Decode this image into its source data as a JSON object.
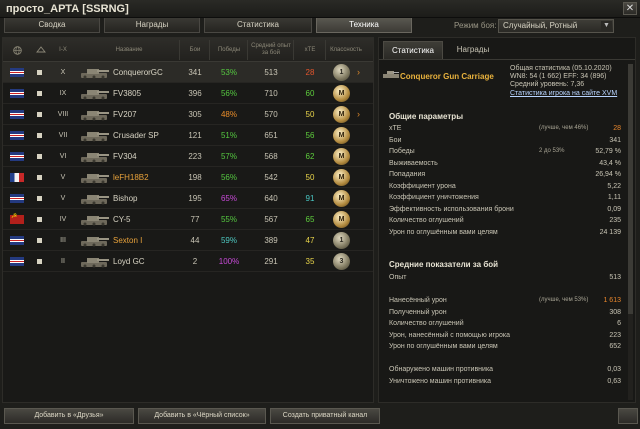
{
  "window": {
    "title": "просто_АРТА [SSRNG]",
    "close_glyph": "✕"
  },
  "tabs": [
    {
      "label": "Сводка"
    },
    {
      "label": "Награды"
    },
    {
      "label": "Статистика"
    },
    {
      "label": "Техника"
    }
  ],
  "battle_mode": {
    "label": "Режим боя:",
    "value": "Случайный, Ротный",
    "arrow": "▼"
  },
  "table": {
    "headers": {
      "name": "Название",
      "battles": "Бои",
      "wins": "Победы",
      "avg_xp": "Средний опыт за бой",
      "xte": "xTE",
      "mastery": "Классность",
      "tier": "I-X"
    },
    "rows": [
      {
        "nation": "uk",
        "tier": "X",
        "name": "ConquerorGC",
        "battles": "341",
        "wins": "53%",
        "wins_color": "green",
        "xp": "513",
        "xte": "28",
        "xte_color": "red",
        "mastery": "1",
        "selected": true,
        "arrow": "›"
      },
      {
        "nation": "uk",
        "tier": "IX",
        "name": "FV3805",
        "battles": "396",
        "wins": "56%",
        "wins_color": "green",
        "xp": "710",
        "xte": "60",
        "xte_color": "green",
        "mastery": "M",
        "selected": false,
        "arrow": ""
      },
      {
        "nation": "uk",
        "tier": "VIII",
        "name": "FV207",
        "battles": "305",
        "wins": "48%",
        "wins_color": "orange",
        "xp": "570",
        "xte": "50",
        "xte_color": "yellow",
        "mastery": "M",
        "selected": false,
        "arrow": "›"
      },
      {
        "nation": "uk",
        "tier": "VII",
        "name": "Crusader SP",
        "battles": "121",
        "wins": "51%",
        "wins_color": "green",
        "xp": "651",
        "xte": "56",
        "xte_color": "green",
        "mastery": "M",
        "selected": false,
        "arrow": ""
      },
      {
        "nation": "uk",
        "tier": "VI",
        "name": "FV304",
        "battles": "223",
        "wins": "57%",
        "wins_color": "green",
        "xp": "568",
        "xte": "62",
        "xte_color": "green",
        "mastery": "M",
        "selected": false,
        "arrow": ""
      },
      {
        "nation": "fr",
        "tier": "V",
        "name": "leFH18B2",
        "battles": "198",
        "wins": "56%",
        "wins_color": "green",
        "xp": "542",
        "xte": "50",
        "xte_color": "yellow",
        "mastery": "M",
        "selected": false,
        "arrow": "",
        "gold": true
      },
      {
        "nation": "uk",
        "tier": "V",
        "name": "Bishop",
        "battles": "195",
        "wins": "65%",
        "wins_color": "purple",
        "xp": "640",
        "xte": "91",
        "xte_color": "cyan",
        "mastery": "M",
        "selected": false,
        "arrow": ""
      },
      {
        "nation": "su",
        "tier": "IV",
        "name": "CY-5",
        "battles": "77",
        "wins": "55%",
        "wins_color": "green",
        "xp": "567",
        "xte": "65",
        "xte_color": "green",
        "mastery": "M",
        "selected": false,
        "arrow": ""
      },
      {
        "nation": "uk",
        "tier": "III",
        "name": "Sexton I",
        "battles": "44",
        "wins": "59%",
        "wins_color": "cyan",
        "xp": "389",
        "xte": "47",
        "xte_color": "yellow",
        "mastery": "1",
        "selected": false,
        "arrow": "",
        "gold": true
      },
      {
        "nation": "uk",
        "tier": "II",
        "name": "Loyd GC",
        "battles": "2",
        "wins": "100%",
        "wins_color": "purple",
        "xp": "291",
        "xte": "35",
        "xte_color": "yellow",
        "mastery": "3",
        "selected": false,
        "arrow": ""
      }
    ]
  },
  "right": {
    "tabs": [
      {
        "label": "Статистика"
      },
      {
        "label": "Награды"
      }
    ],
    "tank_title": "Conqueror Gun Carriage",
    "stat_date": "Общая статистика (05.10.2020)",
    "wn8_line": "WN8: 54 (1 662) EFF: 34 (896)",
    "level_line": "Средний уровень: 7,36",
    "xvm_link": "Статистика игрока на сайте XVM",
    "general": {
      "title": "Общие параметры",
      "items": [
        {
          "k": "xTE",
          "note": "(лучше, чем 46%)",
          "v": "28",
          "color": "orange"
        },
        {
          "k": "Бои",
          "note": "",
          "v": "341",
          "color": ""
        },
        {
          "k": "Победы",
          "note": "2 до 53%",
          "v": "52,79 %",
          "color": ""
        },
        {
          "k": "Выживаемость",
          "note": "",
          "v": "43,4 %",
          "color": ""
        },
        {
          "k": "Попадания",
          "note": "",
          "v": "26,94 %",
          "color": ""
        },
        {
          "k": "Коэффициент урона",
          "note": "",
          "v": "5,22",
          "color": ""
        },
        {
          "k": "Коэффициент уничтожения",
          "note": "",
          "v": "1,11",
          "color": ""
        },
        {
          "k": "Эффективность использования брони",
          "note": "",
          "v": "0,09",
          "color": ""
        },
        {
          "k": "Количество оглушений",
          "note": "",
          "v": "235",
          "color": ""
        },
        {
          "k": "Урон по оглушённым вами целям",
          "note": "",
          "v": "24 139",
          "color": ""
        }
      ]
    },
    "average": {
      "title": "Средние показатели за бой",
      "items": [
        {
          "k": "Опыт",
          "note": "",
          "v": "513",
          "color": ""
        },
        {
          "k": "",
          "note": "",
          "v": "",
          "color": ""
        },
        {
          "k": "Нанесённый урон",
          "note": "(лучше, чем 53%)",
          "v": "1 613",
          "color": "orange"
        },
        {
          "k": "Полученный урон",
          "note": "",
          "v": "308",
          "color": ""
        },
        {
          "k": "Количество оглушений",
          "note": "",
          "v": "6",
          "color": ""
        },
        {
          "k": "Урон, нанесённый с помощью игрока",
          "note": "",
          "v": "223",
          "color": ""
        },
        {
          "k": "Урон по оглушённым вами целям",
          "note": "",
          "v": "652",
          "color": ""
        },
        {
          "k": "",
          "note": "",
          "v": "",
          "color": ""
        },
        {
          "k": "Обнаружено машин противника",
          "note": "",
          "v": "0,03",
          "color": ""
        },
        {
          "k": "Уничтожено машин противника",
          "note": "",
          "v": "0,63",
          "color": ""
        }
      ]
    }
  },
  "bottom": {
    "add_friend": "Добавить в «Друзья»",
    "add_blacklist": "Добавить в «Чёрный список»",
    "create_channel": "Создать приватный канал"
  }
}
